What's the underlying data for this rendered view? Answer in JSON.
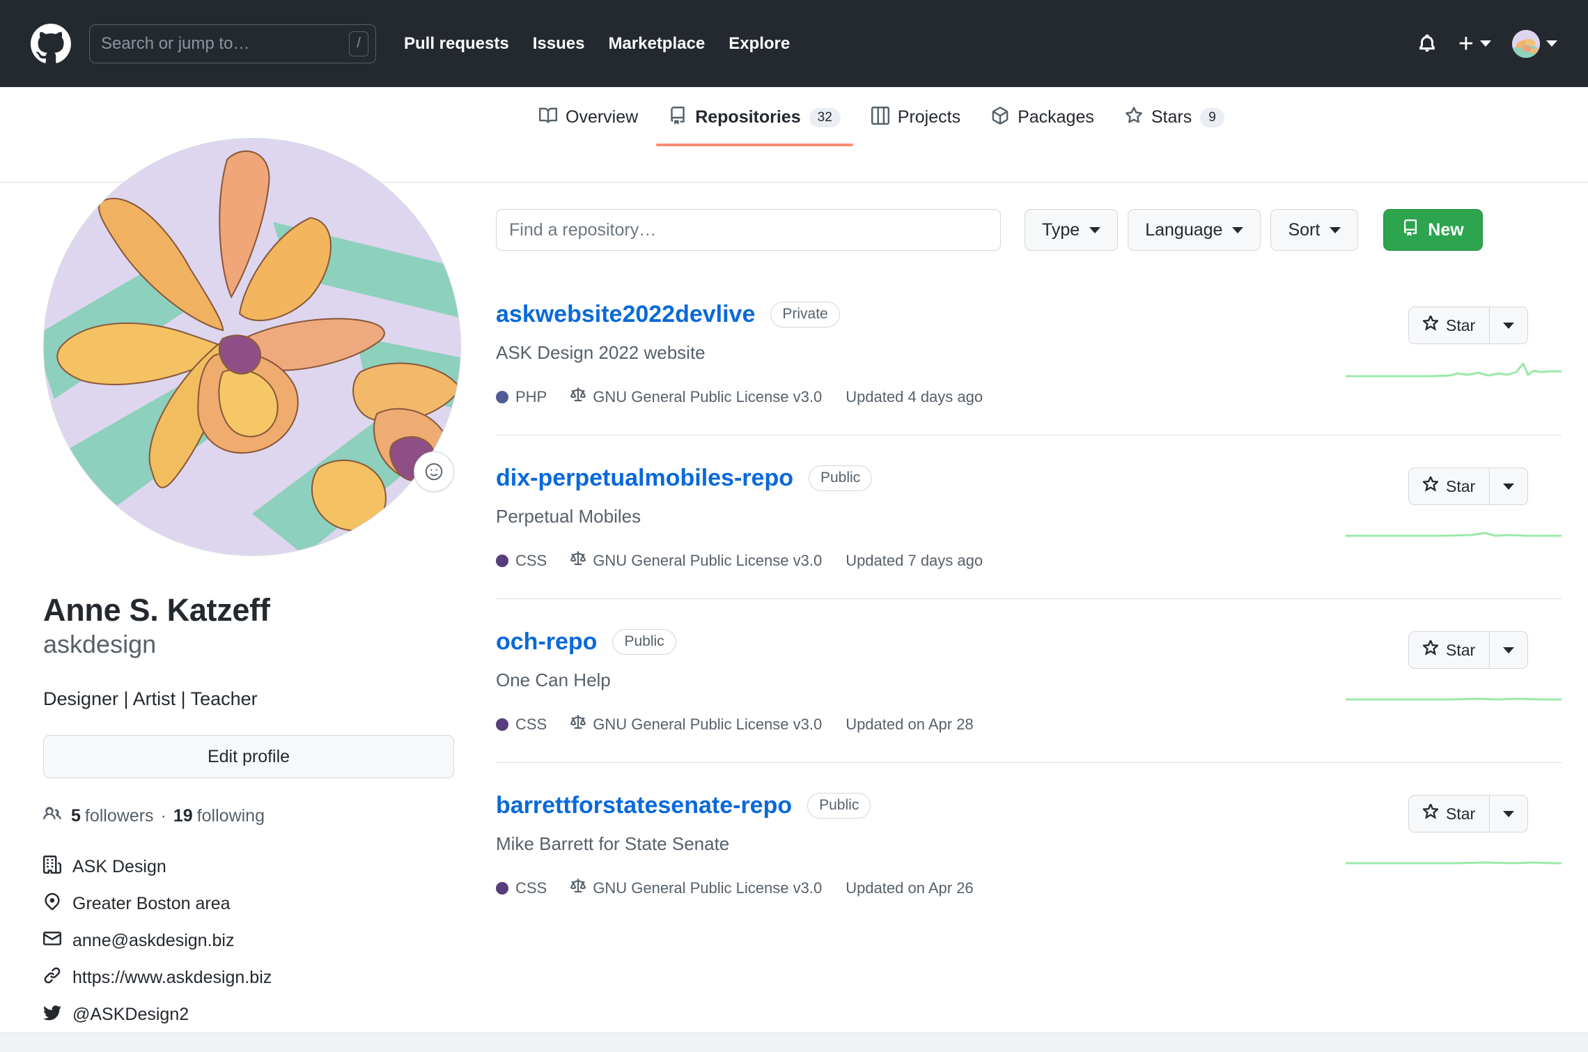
{
  "header": {
    "logo_icon": "github-mark-icon",
    "search": {
      "placeholder": "Search or jump to…",
      "value": "",
      "shortcut": "/"
    },
    "nav": [
      {
        "label": "Pull requests"
      },
      {
        "label": "Issues"
      },
      {
        "label": "Marketplace"
      },
      {
        "label": "Explore"
      }
    ],
    "notifications_icon": "bell-icon",
    "create_new_icon": "plus-icon",
    "create_new_caret_icon": "chevron-down-icon",
    "avatar_icon": "user-avatar",
    "avatar_caret_icon": "chevron-down-icon",
    "background_color": "#24292f"
  },
  "profile_nav": {
    "tabs": [
      {
        "label": "Overview",
        "icon": "book-icon",
        "count": null,
        "active": false
      },
      {
        "label": "Repositories",
        "icon": "repo-icon",
        "count": "32",
        "active": true
      },
      {
        "label": "Projects",
        "icon": "project-icon",
        "count": null,
        "active": false
      },
      {
        "label": "Packages",
        "icon": "package-icon",
        "count": null,
        "active": false
      },
      {
        "label": "Stars",
        "icon": "star-icon",
        "count": "9",
        "active": false
      }
    ],
    "active_underline_color": "#fd8c73"
  },
  "sidebar": {
    "avatar_alt": "watercolor orchid painting avatar",
    "emoji_status_icon": "smiley-icon",
    "name": "Anne S. Katzeff",
    "login": "askdesign",
    "bio": "Designer | Artist | Teacher",
    "edit_profile_label": "Edit profile",
    "followers_count": "5",
    "followers_label": "followers",
    "following_count": "19",
    "following_label": "following",
    "followers_separator": "·",
    "details": [
      {
        "icon": "organization-icon",
        "text": "ASK Design"
      },
      {
        "icon": "location-icon",
        "text": "Greater Boston area"
      },
      {
        "icon": "mail-icon",
        "text": "anne@askdesign.biz"
      },
      {
        "icon": "link-icon",
        "text": "https://www.askdesign.biz"
      },
      {
        "icon": "twitter-icon",
        "text": "@ASKDesign2"
      }
    ]
  },
  "main": {
    "find_placeholder": "Find a repository…",
    "find_value": "",
    "filters": [
      {
        "label": "Type"
      },
      {
        "label": "Language"
      },
      {
        "label": "Sort"
      }
    ],
    "new_button": {
      "label": "New",
      "icon": "repo-icon",
      "color": "#2da44e"
    },
    "star_button_label": "Star",
    "star_icon": "star-icon",
    "star_caret_icon": "chevron-down-icon",
    "license_icon": "law-icon",
    "repos": [
      {
        "name": "askwebsite2022devlive",
        "visibility": "Private",
        "description": "ASK Design 2022 website",
        "language": "PHP",
        "language_color": "#4F5D95",
        "license": "GNU General Public License v3.0",
        "updated": "Updated 4 days ago"
      },
      {
        "name": "dix-perpetualmobiles-repo",
        "visibility": "Public",
        "description": "Perpetual Mobiles",
        "language": "CSS",
        "language_color": "#563d7c",
        "license": "GNU General Public License v3.0",
        "updated": "Updated 7 days ago"
      },
      {
        "name": "och-repo",
        "visibility": "Public",
        "description": "One Can Help",
        "language": "CSS",
        "language_color": "#563d7c",
        "license": "GNU General Public License v3.0",
        "updated": "Updated on Apr 28"
      },
      {
        "name": "barrettforstatesenate-repo",
        "visibility": "Public",
        "description": "Mike Barrett for State Senate",
        "language": "CSS",
        "language_color": "#563d7c",
        "license": "GNU General Public License v3.0",
        "updated": "Updated on Apr 26"
      }
    ],
    "sparkline_color": "#9be9a8"
  }
}
